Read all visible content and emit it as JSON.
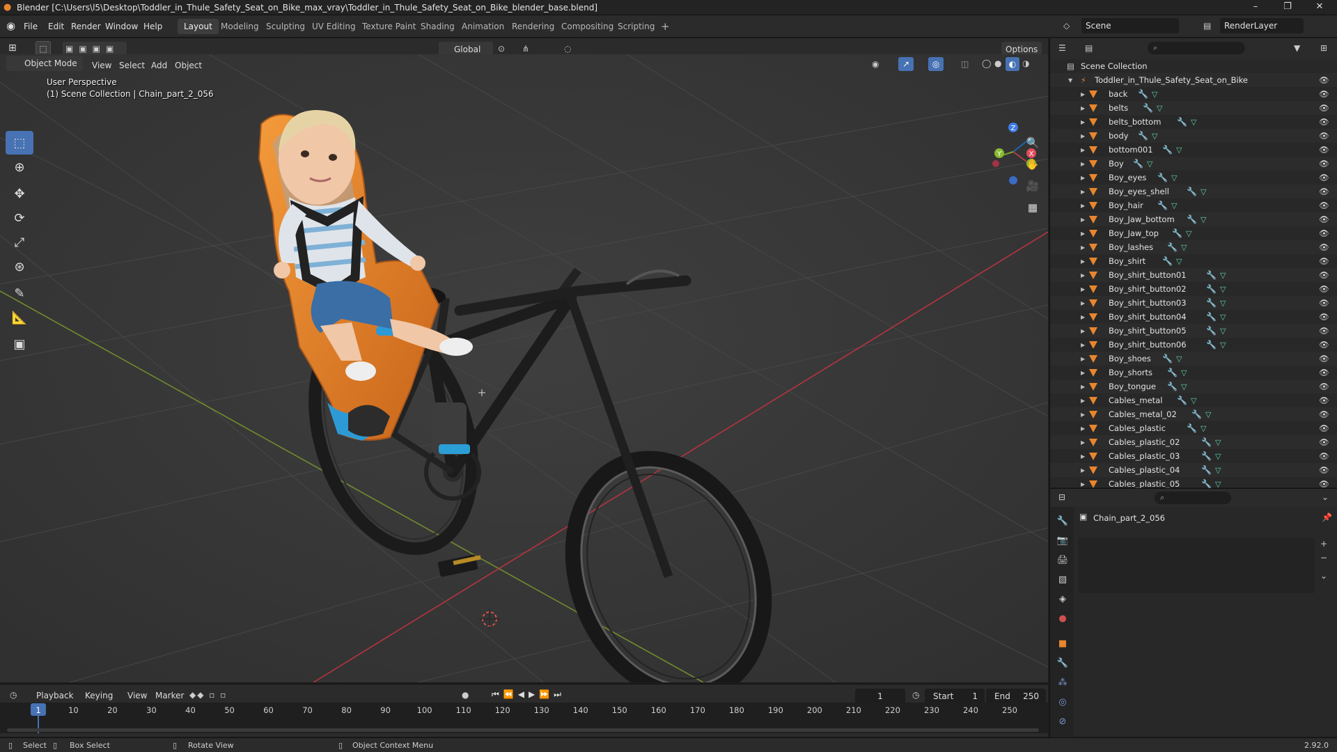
{
  "window": {
    "title": "Blender [C:\\Users\\l5\\Desktop\\Toddler_in_Thule_Safety_Seat_on_Bike_max_vray\\Toddler_in_Thule_Safety_Seat_on_Bike_blender_base.blend]",
    "minimize": "–",
    "maximize": "❐",
    "close": "✕"
  },
  "menubar": {
    "items": [
      "File",
      "Edit",
      "Render",
      "Window",
      "Help"
    ],
    "workspaces": [
      "Layout",
      "Modeling",
      "Sculpting",
      "UV Editing",
      "Texture Paint",
      "Shading",
      "Animation",
      "Rendering",
      "Compositing",
      "Scripting"
    ],
    "active_workspace": "Layout",
    "add_tab": "+",
    "scene": "Scene",
    "render_layer": "RenderLayer"
  },
  "viewport_header": {
    "mode": "Object Mode",
    "menus": [
      "View",
      "Select",
      "Add",
      "Object"
    ],
    "transform_orientation": "Global",
    "options": "Options"
  },
  "viewport": {
    "perspective": "User Perspective",
    "collection_info": "(1) Scene Collection | Chain_part_2_056",
    "gizmo_axes": {
      "x": "X",
      "y": "Y",
      "z": "Z"
    }
  },
  "outliner": {
    "root": "Scene Collection",
    "collection": "Toddler_in_Thule_Safety_Seat_on_Bike",
    "items": [
      "back",
      "belts",
      "belts_bottom",
      "body",
      "bottom001",
      "Boy",
      "Boy_eyes",
      "Boy_eyes_shell",
      "Boy_hair",
      "Boy_Jaw_bottom",
      "Boy_Jaw_top",
      "Boy_lashes",
      "Boy_shirt",
      "Boy_shirt_button01",
      "Boy_shirt_button02",
      "Boy_shirt_button03",
      "Boy_shirt_button04",
      "Boy_shirt_button05",
      "Boy_shirt_button06",
      "Boy_shoes",
      "Boy_shorts",
      "Boy_tongue",
      "Cables_metal",
      "Cables_metal_02",
      "Cables_plastic",
      "Cables_plastic_02",
      "Cables_plastic_03",
      "Cables_plastic_04",
      "Cables_plastic_05"
    ]
  },
  "properties": {
    "object_name": "Chain_part_2_056"
  },
  "timeline": {
    "menus": [
      "Playback",
      "Keying",
      "View",
      "Marker"
    ],
    "current_frame": "1",
    "start_label": "Start",
    "start_value": "1",
    "end_label": "End",
    "end_value": "250",
    "ticks": [
      "1",
      "10",
      "20",
      "30",
      "40",
      "50",
      "60",
      "70",
      "80",
      "90",
      "100",
      "110",
      "120",
      "130",
      "140",
      "150",
      "160",
      "170",
      "180",
      "190",
      "200",
      "210",
      "220",
      "230",
      "240",
      "250"
    ]
  },
  "statusbar": {
    "select": "Select",
    "box_select": "Box Select",
    "rotate_view": "Rotate View",
    "context_menu": "Object Context Menu",
    "version": "2.92.0"
  },
  "colors": {
    "accent": "#4772b3",
    "seat_orange": "#e8862e",
    "x_axis": "#c8364a",
    "y_axis": "#7da22c",
    "mesh_icon": "#5fd3a6",
    "modifier_icon": "#7f98d6"
  }
}
